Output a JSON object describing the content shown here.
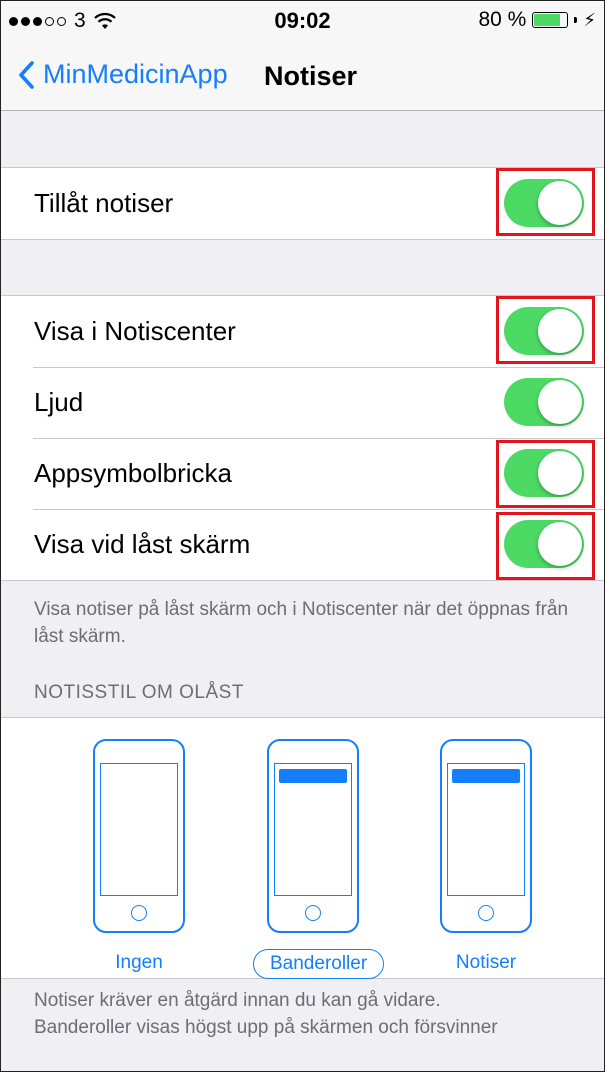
{
  "status_bar": {
    "carrier": "3",
    "time": "09:02",
    "battery": "80 %",
    "battery_level": 0.8
  },
  "nav": {
    "back_label": "MinMedicinApp",
    "title": "Notiser"
  },
  "rows": {
    "allow": {
      "label": "Tillåt notiser",
      "on": true
    },
    "center": {
      "label": "Visa i Notiscenter",
      "on": true
    },
    "sound": {
      "label": "Ljud",
      "on": true
    },
    "badge": {
      "label": "Appsymbolbricka",
      "on": true
    },
    "lock": {
      "label": "Visa vid låst skärm",
      "on": true
    }
  },
  "lock_footnote": "Visa notiser på låst skärm och i Notiscenter när det öppnas från låst skärm.",
  "style_section": {
    "header": "NOTISSTIL OM OLÅST",
    "options": [
      {
        "label": "Ingen",
        "selected": false
      },
      {
        "label": "Banderoller",
        "selected": true
      },
      {
        "label": "Notiser",
        "selected": false
      }
    ]
  },
  "bottom_footnote_line1": "Notiser kräver en åtgärd innan du kan gå vidare.",
  "bottom_footnote_line2": "Banderoller visas högst upp på skärmen och försvinner",
  "colors": {
    "accent": "#147efb",
    "switch_on": "#4cd964",
    "highlight": "#e2151f"
  }
}
